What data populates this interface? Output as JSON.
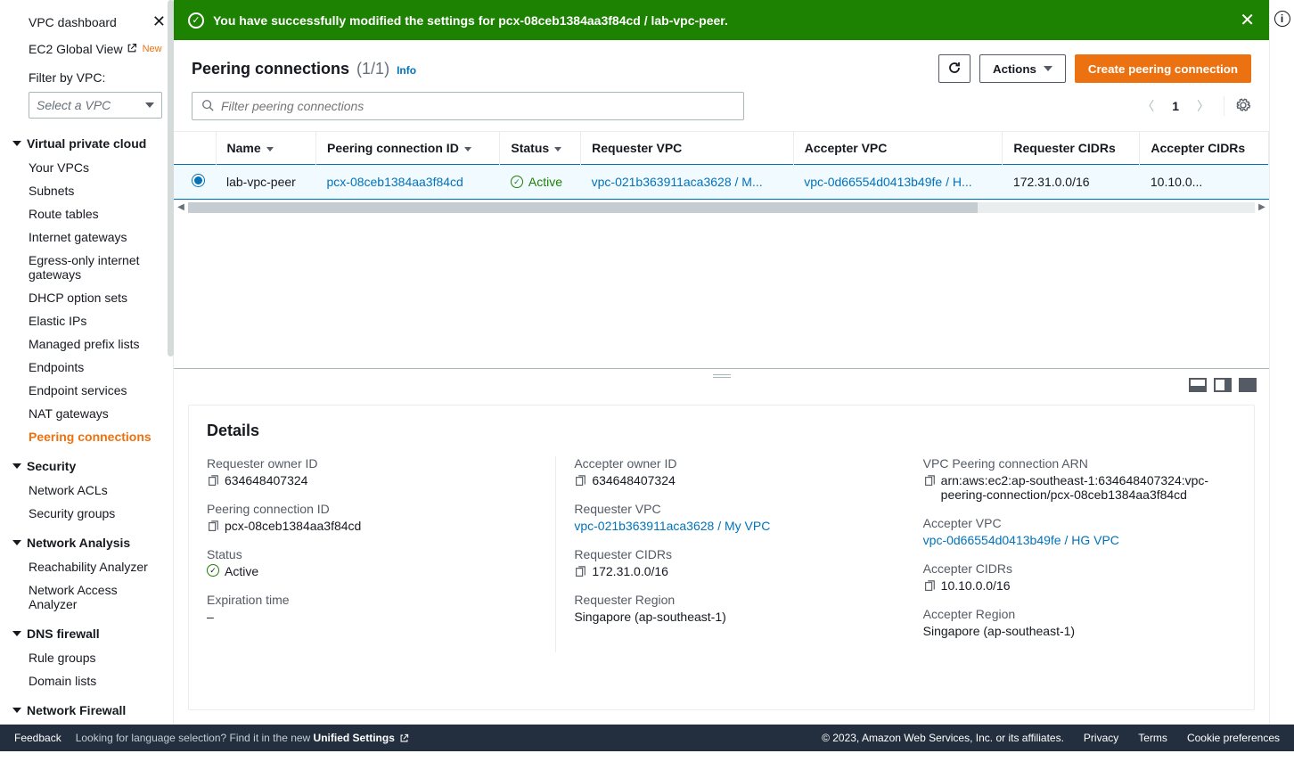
{
  "sidebar": {
    "top": {
      "dashboard": "VPC dashboard",
      "ec2global": "EC2 Global View",
      "new_badge": "New"
    },
    "filter": {
      "label": "Filter by VPC:",
      "placeholder": "Select a VPC"
    },
    "sections": [
      {
        "title": "Virtual private cloud",
        "items": [
          "Your VPCs",
          "Subnets",
          "Route tables",
          "Internet gateways",
          "Egress-only internet gateways",
          "DHCP option sets",
          "Elastic IPs",
          "Managed prefix lists",
          "Endpoints",
          "Endpoint services",
          "NAT gateways",
          "Peering connections"
        ],
        "active_index": 11
      },
      {
        "title": "Security",
        "items": [
          "Network ACLs",
          "Security groups"
        ]
      },
      {
        "title": "Network Analysis",
        "items": [
          "Reachability Analyzer",
          "Network Access Analyzer"
        ]
      },
      {
        "title": "DNS firewall",
        "items": [
          "Rule groups",
          "Domain lists"
        ]
      },
      {
        "title": "Network Firewall",
        "items": []
      }
    ]
  },
  "notification": {
    "message": "You have successfully modified the settings for pcx-08ceb1384aa3f84cd / lab-vpc-peer."
  },
  "header": {
    "title": "Peering connections",
    "count": "(1/1)",
    "info": "Info",
    "actions_label": "Actions",
    "create_label": "Create peering connection",
    "search_placeholder": "Filter peering connections",
    "page": "1"
  },
  "table": {
    "headers": [
      "Name",
      "Peering connection ID",
      "Status",
      "Requester VPC",
      "Accepter VPC",
      "Requester CIDRs",
      "Accepter CIDRs"
    ],
    "row": {
      "name": "lab-vpc-peer",
      "pcx": "pcx-08ceb1384aa3f84cd",
      "status": "Active",
      "requester": "vpc-021b363911aca3628 / M...",
      "accepter": "vpc-0d66554d0413b49fe / H...",
      "req_cidr": "172.31.0.0/16",
      "acc_cidr": "10.10.0..."
    }
  },
  "details": {
    "title": "Details",
    "col1": {
      "req_owner_label": "Requester owner ID",
      "req_owner": "634648407324",
      "pcx_label": "Peering connection ID",
      "pcx": "pcx-08ceb1384aa3f84cd",
      "status_label": "Status",
      "status": "Active",
      "exp_label": "Expiration time",
      "exp": "–"
    },
    "col2": {
      "acc_owner_label": "Accepter owner ID",
      "acc_owner": "634648407324",
      "req_vpc_label": "Requester VPC",
      "req_vpc": "vpc-021b363911aca3628 / My VPC",
      "req_cidr_label": "Requester CIDRs",
      "req_cidr": "172.31.0.0/16",
      "req_region_label": "Requester Region",
      "req_region": "Singapore (ap-southeast-1)"
    },
    "col3": {
      "arn_label": "VPC Peering connection ARN",
      "arn": "arn:aws:ec2:ap-southeast-1:634648407324:vpc-peering-connection/pcx-08ceb1384aa3f84cd",
      "acc_vpc_label": "Accepter VPC",
      "acc_vpc": "vpc-0d66554d0413b49fe / HG VPC",
      "acc_cidr_label": "Accepter CIDRs",
      "acc_cidr": "10.10.0.0/16",
      "acc_region_label": "Accepter Region",
      "acc_region": "Singapore (ap-southeast-1)"
    }
  },
  "footer": {
    "feedback": "Feedback",
    "lang_hint_a": "Looking for language selection? Find it in the new ",
    "lang_hint_b": "Unified Settings",
    "copyright": "© 2023, Amazon Web Services, Inc. or its affiliates.",
    "privacy": "Privacy",
    "terms": "Terms",
    "cookie": "Cookie preferences"
  }
}
